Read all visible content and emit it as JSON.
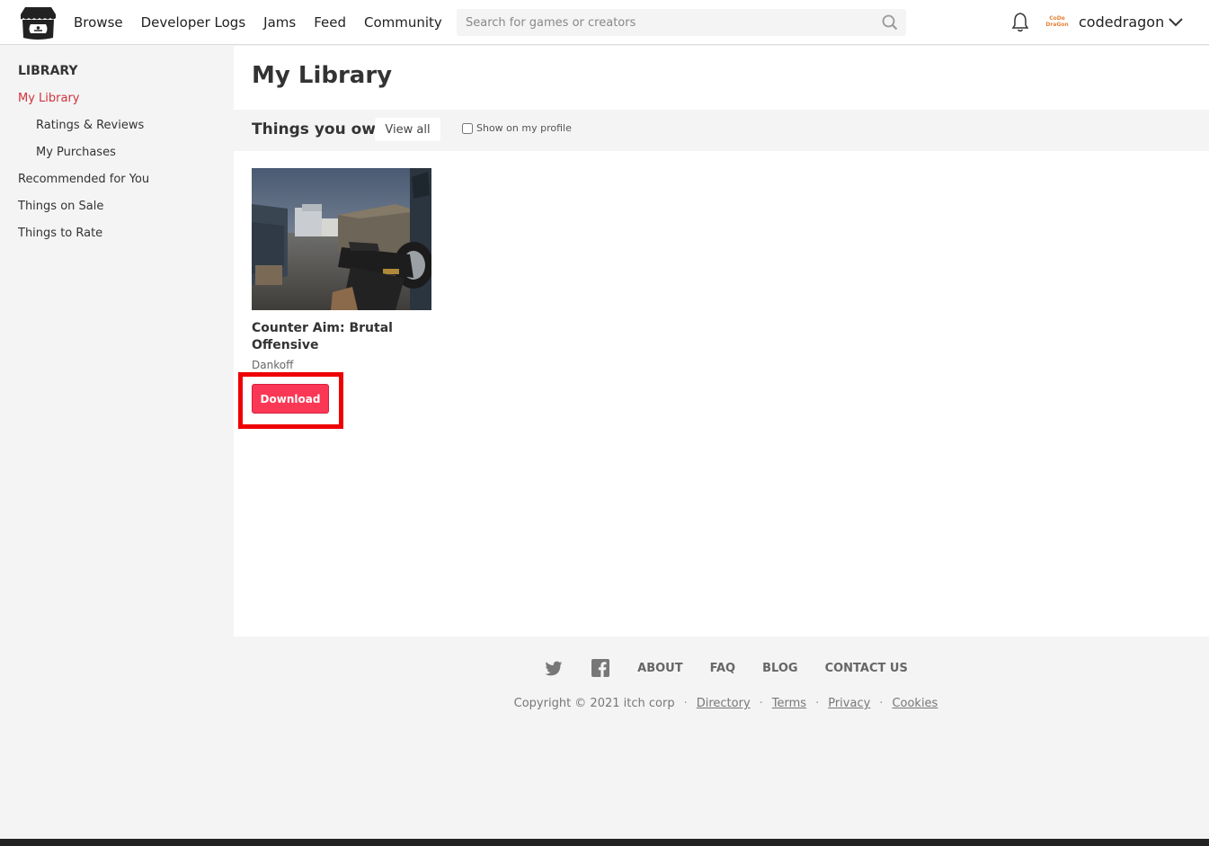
{
  "header": {
    "nav": [
      "Browse",
      "Developer Logs",
      "Jams",
      "Feed",
      "Community"
    ],
    "search_placeholder": "Search for games or creators",
    "avatar_text_line1": "CoDe",
    "avatar_text_line2": "DraGon",
    "username": "codedragon",
    "icons": {
      "logo": "itchio-logo",
      "search": "search-icon",
      "bell": "bell-icon",
      "chevron": "chevron-down-icon"
    }
  },
  "sidebar": {
    "heading": "LIBRARY",
    "items": [
      {
        "label": "My Library",
        "active": true
      },
      {
        "label": "Ratings & Reviews",
        "active": false
      },
      {
        "label": "My Purchases",
        "active": false
      },
      {
        "label": "Recommended for You",
        "active": false
      },
      {
        "label": "Things on Sale",
        "active": false
      },
      {
        "label": "Things to Rate",
        "active": false
      }
    ]
  },
  "main": {
    "title": "My Library",
    "section_title": "Things you own",
    "view_all_label": "View all",
    "show_on_profile_label": "Show on my profile",
    "show_on_profile_checked": false,
    "games": [
      {
        "title": "Counter Aim: Brutal Offensive",
        "author": "Dankoff",
        "download_label": "Download"
      }
    ]
  },
  "footer": {
    "links": [
      "ABOUT",
      "FAQ",
      "BLOG",
      "CONTACT US"
    ],
    "social_icons": [
      "twitter-icon",
      "facebook-icon"
    ],
    "copyright": "Copyright © 2021 itch corp",
    "legal_links": [
      "Directory",
      "Terms",
      "Privacy",
      "Cookies"
    ],
    "separator": "·"
  },
  "colors": {
    "accent": "#fa3755",
    "active_link": "#d1333c",
    "highlight": "#ee0000"
  }
}
